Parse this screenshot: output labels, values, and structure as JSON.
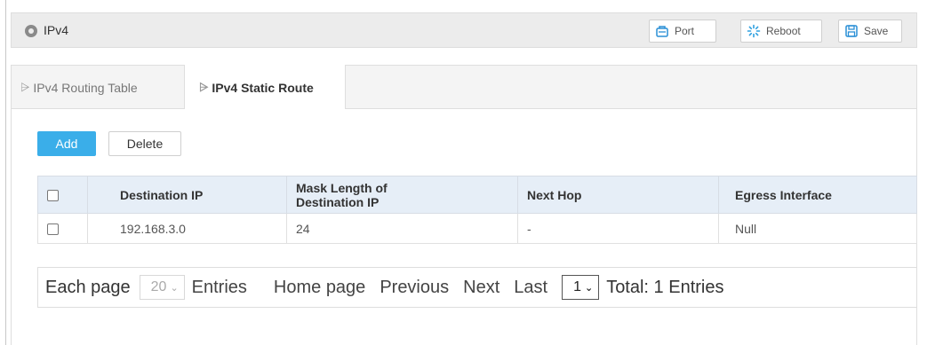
{
  "header": {
    "title": "IPv4",
    "buttons": {
      "port": "Port",
      "reboot": "Reboot",
      "save": "Save"
    }
  },
  "tabs": [
    {
      "label": "IPv4 Routing Table",
      "active": false
    },
    {
      "label": "IPv4 Static Route",
      "active": true
    }
  ],
  "actions": {
    "add": "Add",
    "delete": "Delete"
  },
  "table": {
    "columns": [
      "Destination IP",
      "Mask Length of Destination IP",
      "Next Hop",
      "Egress Interface"
    ],
    "rows": [
      {
        "destination_ip": "192.168.3.0",
        "mask_length": "24",
        "next_hop": "-",
        "egress_interface": "Null"
      }
    ]
  },
  "pager": {
    "each_page": "Each page",
    "page_size": "20",
    "entries": "Entries",
    "home": "Home page",
    "previous": "Previous",
    "next": "Next",
    "last": "Last",
    "current_page": "1",
    "total": "Total: 1 Entries"
  },
  "colors": {
    "accent": "#3aaee9",
    "table_header": "#e6eef7"
  }
}
